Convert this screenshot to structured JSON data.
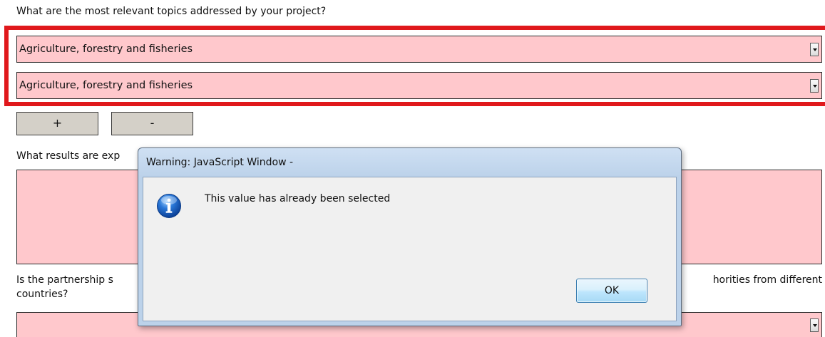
{
  "form": {
    "question_topics": "What are the most relevant topics addressed by your project?",
    "topic_selects": [
      {
        "value": "Agriculture, forestry and fisheries"
      },
      {
        "value": "Agriculture, forestry and fisheries"
      }
    ],
    "add_button_label": "+",
    "remove_button_label": "-",
    "question_results_partial": "What results are exp",
    "question_partnership_left": "Is the partnership s",
    "question_partnership_right": "horities from different",
    "question_partnership_line2": "countries?"
  },
  "dialog": {
    "title": "Warning: JavaScript Window -",
    "message": "This value has already been selected",
    "icon": "info-icon",
    "ok_label": "OK"
  },
  "colors": {
    "field_fill": "#ffc8cc",
    "highlight_border": "#e0181c",
    "button_gray": "#d4d0c8"
  }
}
